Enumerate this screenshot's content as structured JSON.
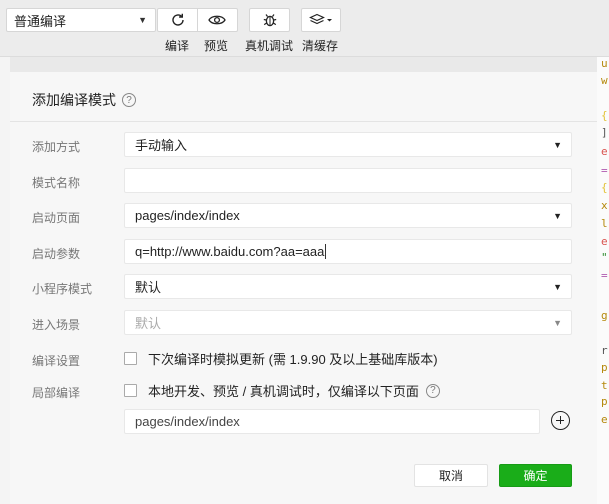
{
  "toolbar": {
    "mode_select": {
      "value": "普通编译"
    },
    "buttons": [
      {
        "icon": "refresh-icon",
        "label": "编译"
      },
      {
        "icon": "eye-icon",
        "label": "预览"
      },
      {
        "icon": "bug-icon",
        "label": "真机调试"
      },
      {
        "icon": "layers-icon",
        "label": "清缓存"
      }
    ]
  },
  "dialog": {
    "title": "添加编译模式",
    "help_glyph": "?",
    "fields": {
      "add_method": {
        "label": "添加方式",
        "value": "手动输入"
      },
      "mode_name": {
        "label": "模式名称",
        "value": ""
      },
      "start_page": {
        "label": "启动页面",
        "value": "pages/index/index"
      },
      "start_params": {
        "label": "启动参数",
        "value": "q=http://www.baidu.com?aa=aaa"
      },
      "miniprogram_mode": {
        "label": "小程序模式",
        "value": "默认"
      },
      "entry_scene": {
        "label": "进入场景",
        "value": "默认"
      },
      "compile_settings": {
        "label": "编译设置",
        "checkbox_text": "下次编译时模拟更新 (需 1.9.90 及以上基础库版本)",
        "checked": false
      },
      "partial_compile": {
        "label": "局部编译",
        "checkbox_text": "本地开发、预览 / 真机调试时，仅编译以下页面",
        "checked": false,
        "page_path": "pages/index/index"
      }
    },
    "cancel_label": "取消",
    "confirm_label": "确定",
    "accent_color": "#1aad19"
  },
  "code_strip": {
    "chars": [
      {
        "c": "u",
        "color": "#b5890c"
      },
      {
        "c": "w",
        "color": "#b5890c"
      },
      {
        "c": "{",
        "color": "#e3c33a"
      },
      {
        "c": "]",
        "color": "#555555"
      },
      {
        "c": "e",
        "color": "#d9534f"
      },
      {
        "c": "=",
        "color": "#b05ab0"
      },
      {
        "c": "{",
        "color": "#e3c33a"
      },
      {
        "c": "x",
        "color": "#b5890c"
      },
      {
        "c": "l",
        "color": "#b5890c"
      },
      {
        "c": "e",
        "color": "#d9534f"
      },
      {
        "c": "\"",
        "color": "#2d8a2d"
      },
      {
        "c": "=",
        "color": "#b05ab0"
      },
      {
        "c": "g",
        "color": "#b5890c"
      },
      {
        "c": "r",
        "color": "#555555"
      },
      {
        "c": "p",
        "color": "#b5890c"
      },
      {
        "c": "t",
        "color": "#b5890c"
      },
      {
        "c": "p",
        "color": "#b5890c"
      },
      {
        "c": "e",
        "color": "#b5890c"
      }
    ]
  }
}
